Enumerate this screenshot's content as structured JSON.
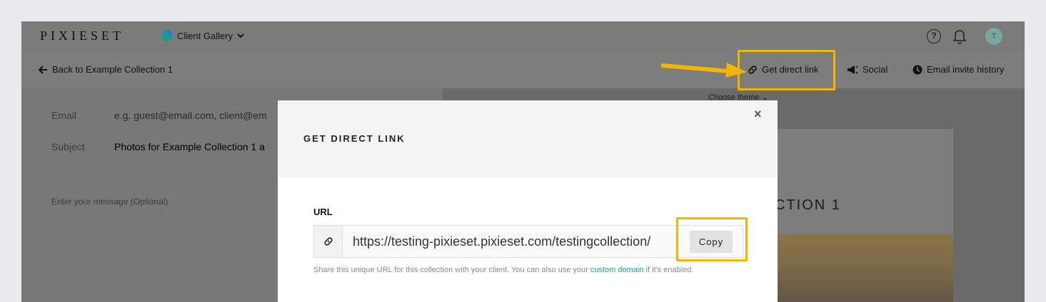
{
  "app": {
    "logo": "PIXIESET",
    "gallery_switch": "Client Gallery",
    "avatar_initial": "T",
    "help_glyph": "?"
  },
  "subbar": {
    "back_label": "Back to Example Collection 1",
    "direct_link_label": "Get direct link",
    "social_label": "Social",
    "email_history_label": "Email invite history"
  },
  "form": {
    "email_label": "Email",
    "email_placeholder": "e.g. guest@email.com, client@em",
    "subject_label": "Subject",
    "subject_value": "Photos for Example Collection 1 a",
    "message_placeholder": "Enter your message (Optional)"
  },
  "preview": {
    "theme_label": "Choose theme",
    "title_fragment": "CTION 1"
  },
  "modal": {
    "title": "GET DIRECT LINK",
    "close_glyph": "×",
    "url_label": "URL",
    "url_value": "https://testing-pixieset.pixieset.com/testingcollection/",
    "copy_label": "Copy",
    "help_prefix": "Share this unique URL for this collection with your client. You can also use your ",
    "help_link": "custom domain",
    "help_suffix": " if it's enabled."
  },
  "colors": {
    "highlight": "#f2b500",
    "accent_teal": "#1aa28c",
    "overlay_gray": "#7b7b7b"
  },
  "icons": [
    "caret-down-icon",
    "help-icon",
    "bell-icon",
    "back-arrow-icon",
    "link-icon",
    "megaphone-icon",
    "clock-icon",
    "close-icon"
  ]
}
